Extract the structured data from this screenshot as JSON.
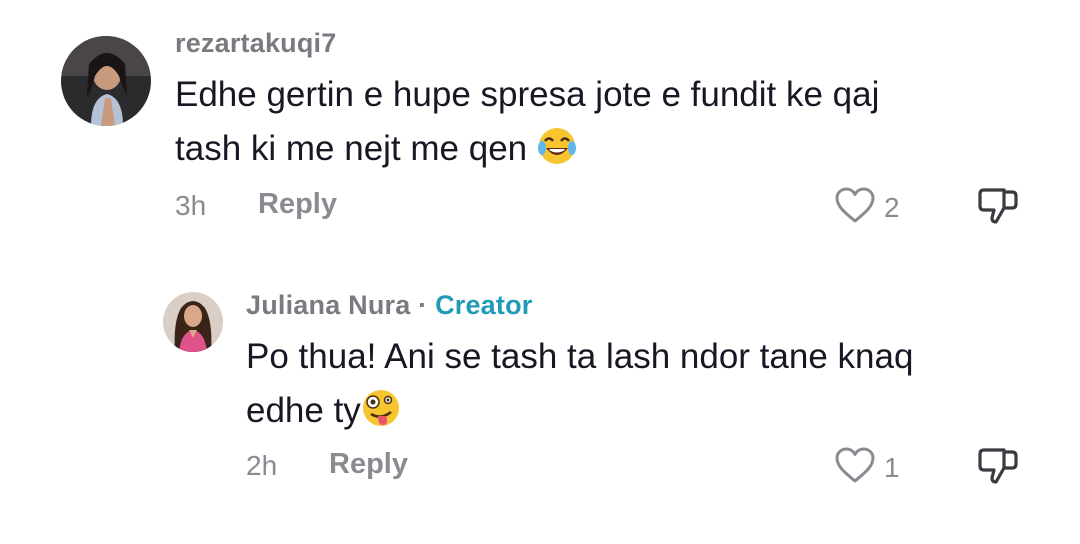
{
  "comments": [
    {
      "username": "rezartakuqi7",
      "text_line1": "Edhe gertin e hupe spresa jote e fundit ke qaj",
      "text_line2": "tash ki me nejt me qen",
      "emoji": "laughing-tears",
      "time": "3h",
      "reply_label": "Reply",
      "like_count": "2"
    },
    {
      "username": "Juliana Nura",
      "separator": "·",
      "creator_label": "Creator",
      "text_line1": "Po thua! Ani se tash ta lash ndor tane knaq",
      "text_line2": "edhe ty",
      "emoji": "zany-face",
      "time": "2h",
      "reply_label": "Reply",
      "like_count": "1"
    }
  ],
  "colors": {
    "username": "#7a7b80",
    "creator": "#1f9bb8",
    "text": "#161823",
    "meta": "#8a8b91"
  }
}
